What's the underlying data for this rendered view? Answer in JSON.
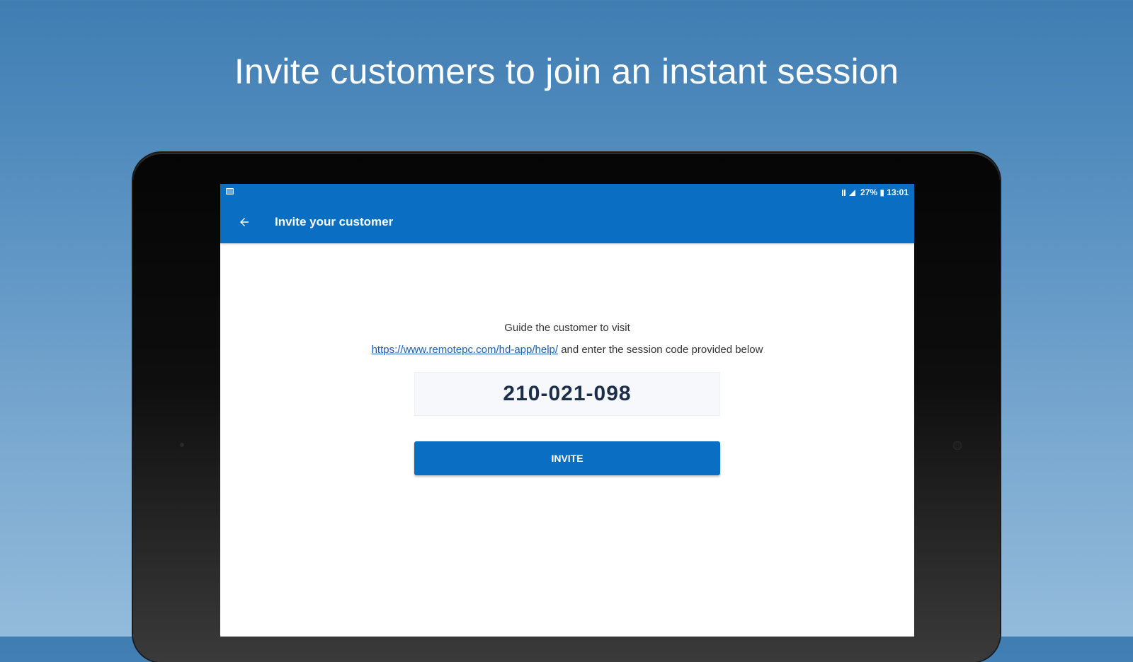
{
  "headline": "Invite customers to join an instant session",
  "status_bar": {
    "right_text": "27% ▮ 13:01",
    "left_icon": "image-notification-icon",
    "signal_icon": "signal-icon"
  },
  "app_bar": {
    "title": "Invite your customer",
    "back_icon": "arrow-back-icon"
  },
  "guide": {
    "line1": "Guide the customer to visit",
    "link": "https://www.remotepc.com/hd-app/help/",
    "line2_rest": "and enter the session code provided below"
  },
  "session_code": "210-021-098",
  "invite_button_label": "INVITE",
  "colors": {
    "primary": "#0a6fc2",
    "background_top": "#3f7db2",
    "background_bottom": "#93bbdb"
  }
}
